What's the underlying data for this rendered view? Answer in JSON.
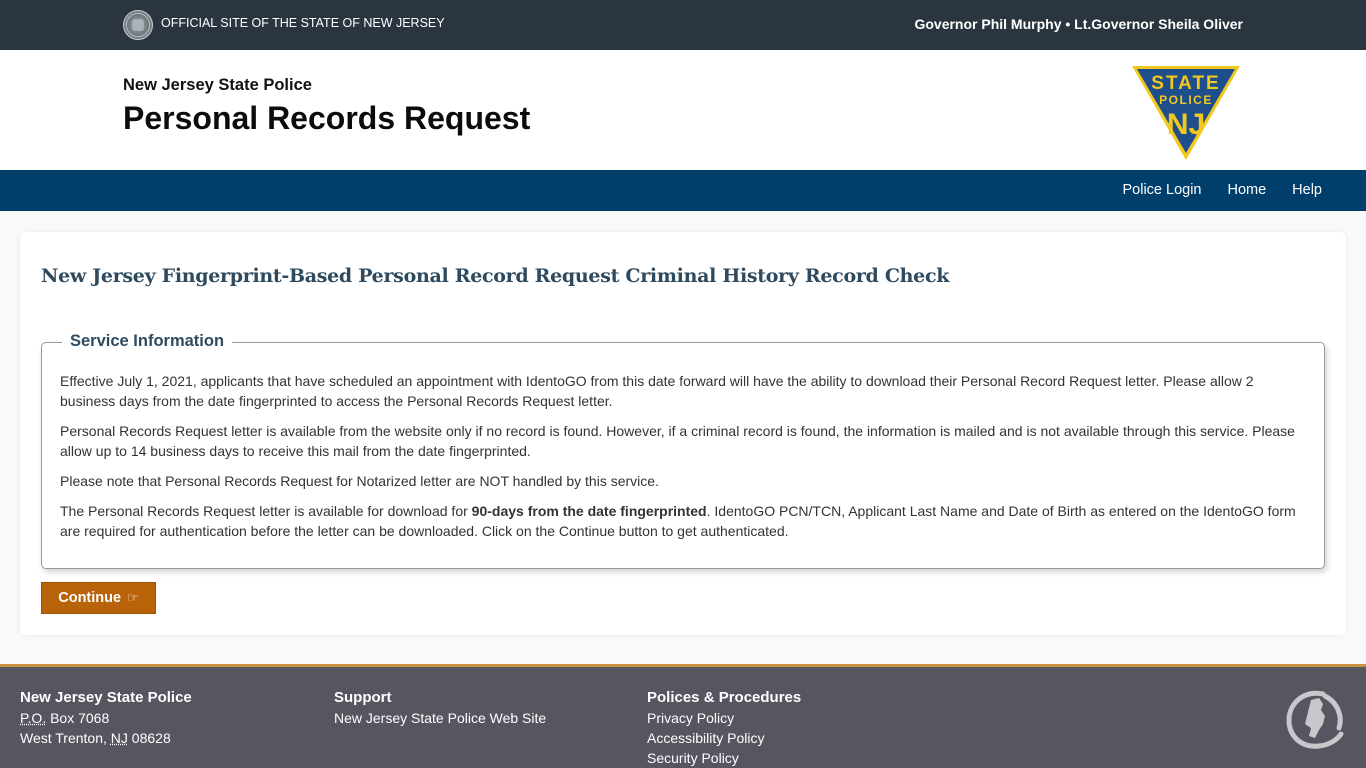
{
  "topbar": {
    "official_text": "OFFICIAL SITE OF THE STATE OF NEW JERSEY",
    "governor_text": "Governor Phil Murphy • Lt.Governor Sheila Oliver"
  },
  "header": {
    "agency": "New Jersey State Police",
    "title": "Personal Records Request",
    "badge": {
      "line1": "STATE",
      "line2": "POLICE",
      "line3": "NJ"
    }
  },
  "nav": {
    "items": [
      {
        "label": "Police Login"
      },
      {
        "label": "Home"
      },
      {
        "label": "Help"
      }
    ]
  },
  "main": {
    "heading": "New Jersey Fingerprint-Based Personal Record Request Criminal History Record Check",
    "service_info": {
      "legend": "Service Information",
      "paragraphs": [
        "Effective July 1, 2021, applicants that have scheduled an appointment with IdentoGO from this date forward will have the ability to download their Personal Record Request letter. Please allow 2 business days from the date fingerprinted to access the Personal Records Request letter.",
        "Personal Records Request letter is available from the website only if no record is found. However, if a criminal record is found, the information is mailed and is not available through this service. Please allow up to 14 business days to receive this mail from the date fingerprinted.",
        "Please note that Personal Records Request for Notarized letter are NOT handled by this service."
      ],
      "last_paragraph": {
        "before": "The Personal Records Request letter is available for download for ",
        "bold": "90-days from the date fingerprinted",
        "after": ". IdentoGO PCN/TCN, Applicant Last Name and Date of Birth as entered on the IdentoGO form are required for authentication before the letter can be downloaded. Click on the Continue button to get authenticated."
      }
    },
    "continue_label": "Continue",
    "continue_icon": "☞"
  },
  "footer": {
    "col1": {
      "title": "New Jersey State Police",
      "po_abbr": "P.O.",
      "po_rest": " Box 7068",
      "city": "West Trenton, ",
      "state_abbr": "NJ",
      "zip": " 08628"
    },
    "col2": {
      "title": "Support",
      "links": [
        "New Jersey State Police Web Site"
      ]
    },
    "col3": {
      "title": "Polices & Procedures",
      "links": [
        "Privacy Policy",
        "Accessibility Policy",
        "Security Policy"
      ]
    }
  },
  "colors": {
    "topbar": "#2a3540",
    "navbar": "#003f6c",
    "heading": "#2e4a5f",
    "button": "#b8620a",
    "footer": "#55565f",
    "footer_accent": "#c8913f",
    "badge_blue": "#1f4e8c",
    "badge_gold": "#f2c81e"
  }
}
